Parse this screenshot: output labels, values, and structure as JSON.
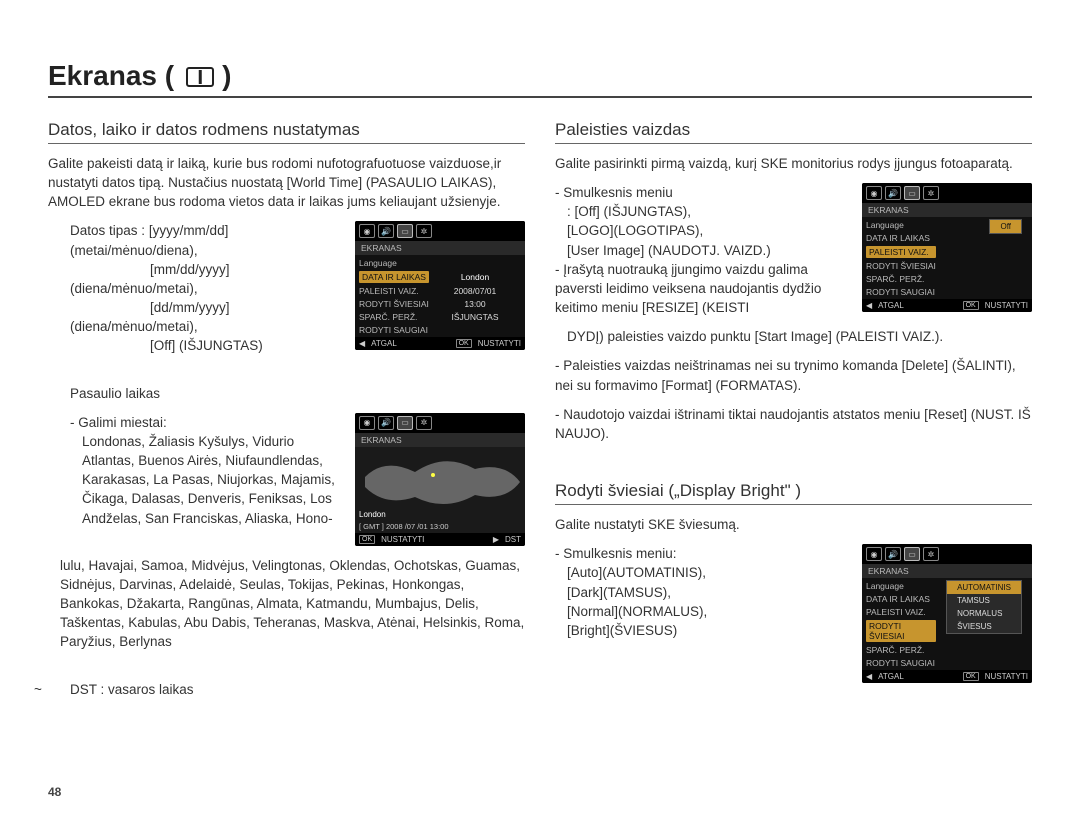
{
  "page": {
    "title_prefix": "Ekranas (",
    "title_suffix": ")",
    "number": "48"
  },
  "left": {
    "h1": "Datos, laiko ir datos rodmens nustatymas",
    "p1": "Galite pakeisti datą ir laiką, kurie bus rodomi nufotografuotuose vaizduose,ir nustatyti datos tipą. Nustačius nuostatą [World Time] (PASAULIO LAIKAS), AMOLED ekrane bus rodoma vietos data ir laikas jums keliaujant užsienyje.",
    "date_type_label": "Datos tipas :",
    "date_type_lines": [
      "[yyyy/mm/dd] (metai/mėnuo/diena),",
      "[mm/dd/yyyy] (diena/mėnuo/metai),",
      "[dd/mm/yyyy] (diena/mėnuo/metai),",
      "[Off] (IŠJUNGTAS)"
    ],
    "world_head": "Pasaulio laikas",
    "world_cities_label": "- Galimi miestai:",
    "world_cities": "Londonas, Žaliasis Kyšulys, Vidurio Atlantas, Buenos Airės, Niufaundlendas, Karakasas, La Pasas, Niujorkas, Majamis, Čikaga, Dalasas, Denveris, Feniksas, Los Andželas, San Franciskas, Aliaska, Hono-",
    "world_cities_cont": "lulu, Havajai, Samoa, Midvėjus, Velingtonas, Oklendas, Ochotskas, Guamas, Sidnėjus, Darvinas, Adelaidė, Seulas, Tokijas, Pekinas, Honkongas, Bankokas, Džakarta, Rangūnas, Almata, Katmandu, Mumbajus, Delis, Taškentas, Kabulas, Abu Dabis, Teheranas, Maskva, Atėnai, Helsinkis, Roma, Paryžius, Berlynas",
    "dst_note": "DST : vasaros laikas"
  },
  "right": {
    "h1": "Paleisties vaizdas",
    "p1": "Galite pasirinkti pirmą vaizdą, kurį SKE monitorius rodys įjungus fotoaparatą.",
    "sub_label": "- Smulkesnis meniu",
    "sub_lines": [
      ": [Off] (IŠJUNGTAS),",
      " [LOGO](LOGOTIPAS),",
      " [User Image] (NAUDOTJ. VAIZD.)"
    ],
    "bullets": [
      "- Įrašytą nuotrauką įjungimo vaizdu galima paversti leidimo veiksena naudojantis dydžio keitimo meniu [RESIZE] (KEISTI",
      "DYDĮ) paleisties vaizdo punktu [Start Image] (PALEISTI VAIZ.).",
      "- Paleisties vaizdas neištrinamas nei su trynimo komanda [Delete] (ŠALINTI), nei su formavimo [Format] (FORMATAS).",
      "- Naudotojo vaizdai ištrinami tiktai naudojantis atstatos meniu [Reset] (NUST. IŠ NAUJO)."
    ],
    "h2": "Rodyti šviesiai („Display Bright\" )",
    "p2": "Galite nustatyti SKE šviesumą.",
    "sub2_label": "- Smulkesnis meniu:",
    "sub2_lines": [
      "[Auto](AUTOMATINIS),",
      "[Dark](TAMSUS),",
      "[Normal](NORMALUS),",
      "[Bright](ŠVIESUS)"
    ]
  },
  "fig1": {
    "head": "EKRANAS",
    "rows": [
      {
        "l": "Language",
        "r": ""
      },
      {
        "l": "DATA IR LAIKAS",
        "r": "London",
        "active": true
      },
      {
        "l": "PALEISTI VAIZ.",
        "r": "2008/07/01"
      },
      {
        "l": "RODYTI ŠVIESIAI",
        "r": "13:00"
      },
      {
        "l": "SPARČ. PERŽ.",
        "r": "IŠJUNGTAS"
      },
      {
        "l": "RODYTI SAUGIAI",
        "r": ""
      }
    ],
    "back": "ATGAL",
    "ok": "OK",
    "set": "NUSTATYTI"
  },
  "fig2": {
    "head": "EKRANAS",
    "city": "London",
    "gmt": "[ GMT ]     2008 /07 /01     13:00",
    "ok": "OK",
    "set": "NUSTATYTI",
    "dst": "DST"
  },
  "fig3": {
    "head": "EKRANAS",
    "rows": [
      {
        "l": "Language",
        "r": ""
      },
      {
        "l": "DATA IR LAIKAS",
        "r": ""
      },
      {
        "l": "PALEISTI VAIZ.",
        "r": "",
        "active": true
      },
      {
        "l": "RODYTI ŠVIESIAI",
        "r": ""
      },
      {
        "l": "SPARČ. PERŽ.",
        "r": ""
      },
      {
        "l": "RODYTI SAUGIAI",
        "r": ""
      }
    ],
    "submenu": [
      "Off"
    ],
    "back": "ATGAL",
    "ok": "OK",
    "set": "NUSTATYTI"
  },
  "fig4": {
    "head": "EKRANAS",
    "rows": [
      {
        "l": "Language",
        "r": ""
      },
      {
        "l": "DATA IR LAIKAS",
        "r": ""
      },
      {
        "l": "PALEISTI VAIZ.",
        "r": ""
      },
      {
        "l": "RODYTI ŠVIESIAI",
        "r": "",
        "active": true
      },
      {
        "l": "SPARČ. PERŽ.",
        "r": ""
      },
      {
        "l": "RODYTI SAUGIAI",
        "r": ""
      }
    ],
    "submenu": [
      "AUTOMATINIS",
      "TAMSUS",
      "NORMALUS",
      "ŠVIESUS"
    ],
    "back": "ATGAL",
    "ok": "OK",
    "set": "NUSTATYTI"
  }
}
